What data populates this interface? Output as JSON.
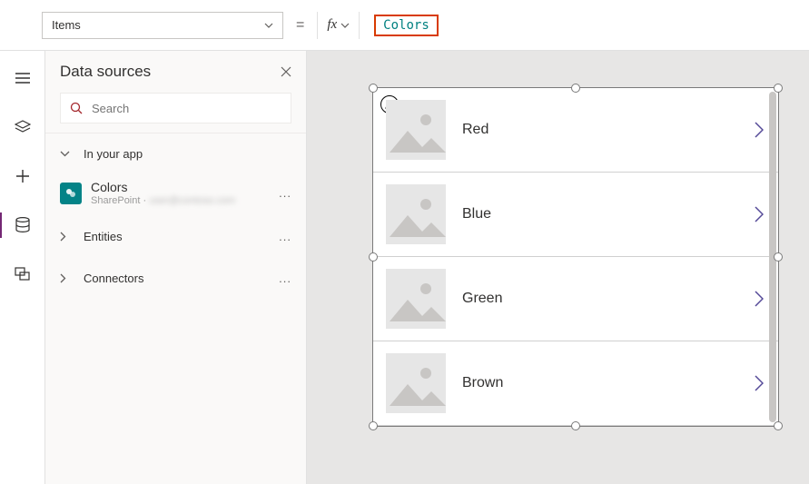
{
  "topbar": {
    "property_label": "Items",
    "equals": "=",
    "fx_label": "fx",
    "formula_value": "Colors"
  },
  "iconrail": {
    "items": [
      {
        "name": "hamburger-icon"
      },
      {
        "name": "layers-icon"
      },
      {
        "name": "plus-icon"
      },
      {
        "name": "data-icon"
      },
      {
        "name": "media-icon"
      }
    ],
    "active_index": 3
  },
  "panel": {
    "title": "Data sources",
    "search_placeholder": "Search",
    "sections": {
      "in_app": {
        "label": "In your app",
        "expanded": true
      },
      "entities": {
        "label": "Entities",
        "expanded": false
      },
      "connectors": {
        "label": "Connectors",
        "expanded": false
      }
    },
    "datasource": {
      "name": "Colors",
      "type_label": "SharePoint",
      "separator": " · ",
      "owner_blurred": "user@contoso.com"
    },
    "more_label": "..."
  },
  "gallery": {
    "items": [
      {
        "label": "Red"
      },
      {
        "label": "Blue"
      },
      {
        "label": "Green"
      },
      {
        "label": "Brown"
      }
    ]
  }
}
